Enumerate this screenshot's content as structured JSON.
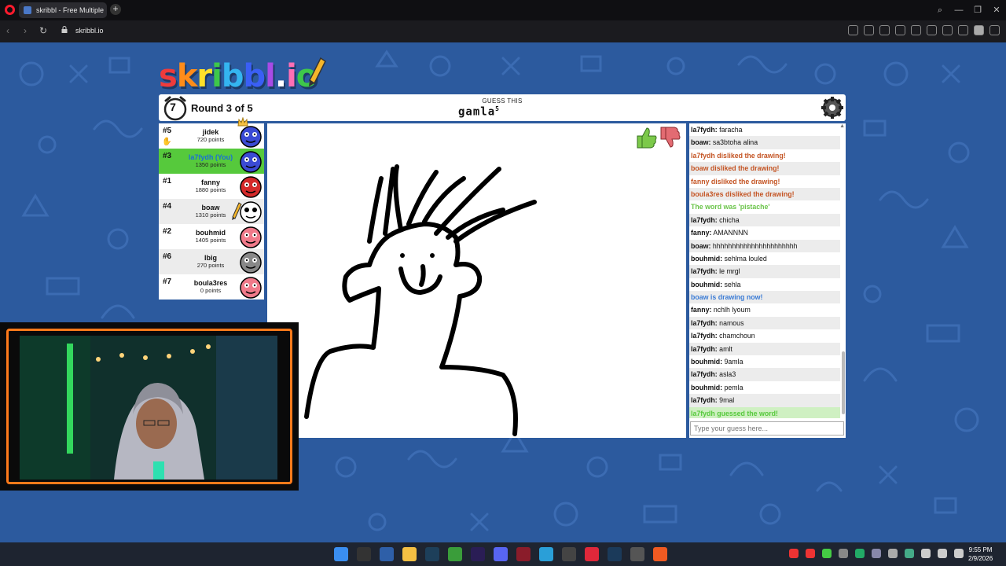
{
  "browser": {
    "tab_title": "skribbl - Free Multiple",
    "tab_close": "×",
    "new_tab": "+",
    "url": "skribbl.io",
    "window_buttons": [
      "—",
      "❐",
      "✕"
    ]
  },
  "game": {
    "logo_text": "skribbl.io",
    "timer": "7",
    "round_text": "Round 3 of 5",
    "guess_label": "GUESS THIS",
    "guess_word": "gamla",
    "word_length": "5"
  },
  "players": [
    {
      "rank": "#5",
      "name": "jidek",
      "points": "720 points",
      "face_color": "#3b4bd4"
    },
    {
      "rank": "#3",
      "name": "la7fydh (You)",
      "points": "1350 points",
      "face_color": "#3b4bd4"
    },
    {
      "rank": "#1",
      "name": "fanny",
      "points": "1880 points",
      "face_color": "#d42a2a"
    },
    {
      "rank": "#4",
      "name": "boaw",
      "points": "1310 points",
      "face_color": "#ffffff"
    },
    {
      "rank": "#2",
      "name": "bouhmid",
      "points": "1405 points",
      "face_color": "#f07a8a"
    },
    {
      "rank": "#6",
      "name": "lbig",
      "points": "270 points",
      "face_color": "#888888"
    },
    {
      "rank": "#7",
      "name": "boula3res",
      "points": "0 points",
      "face_color": "#f07a8a"
    }
  ],
  "chat": {
    "messages": [
      {
        "type": "chat",
        "user": "la7fydh:",
        "text": " faracha"
      },
      {
        "type": "chat",
        "user": "boaw:",
        "text": " sa3btoha alina"
      },
      {
        "type": "disliked",
        "user": "",
        "text": "la7fydh disliked the drawing!"
      },
      {
        "type": "disliked",
        "user": "",
        "text": "boaw disliked the drawing!"
      },
      {
        "type": "disliked",
        "user": "",
        "text": "fanny disliked the drawing!"
      },
      {
        "type": "disliked",
        "user": "",
        "text": "boula3res disliked the drawing!"
      },
      {
        "type": "word",
        "user": "",
        "text": "The word was 'pistache'"
      },
      {
        "type": "chat",
        "user": "la7fydh:",
        "text": " chicha"
      },
      {
        "type": "chat",
        "user": "fanny:",
        "text": " AMANNNN"
      },
      {
        "type": "chat",
        "user": "boaw:",
        "text": " hhhhhhhhhhhhhhhhhhhhhh"
      },
      {
        "type": "chat",
        "user": "bouhmid:",
        "text": " sehlma louled"
      },
      {
        "type": "chat",
        "user": "la7fydh:",
        "text": " le mrgl"
      },
      {
        "type": "chat",
        "user": "bouhmid:",
        "text": " sehla"
      },
      {
        "type": "drawing",
        "user": "",
        "text": "boaw is drawing now!"
      },
      {
        "type": "chat",
        "user": "fanny:",
        "text": " nchlh lyoum"
      },
      {
        "type": "chat",
        "user": "la7fydh:",
        "text": " namous"
      },
      {
        "type": "chat",
        "user": "la7fydh:",
        "text": " chamchoun"
      },
      {
        "type": "chat",
        "user": "la7fydh:",
        "text": " amlt"
      },
      {
        "type": "chat",
        "user": "bouhmid:",
        "text": " 9amla"
      },
      {
        "type": "chat",
        "user": "la7fydh:",
        "text": " asla3"
      },
      {
        "type": "chat",
        "user": "bouhmid:",
        "text": " pemla"
      },
      {
        "type": "chat",
        "user": "la7fydh:",
        "text": " 9mal"
      },
      {
        "type": "guessed",
        "user": "",
        "text": "la7fydh guessed the word!"
      }
    ],
    "input_placeholder": "Type your guess here..."
  },
  "taskbar": {
    "time": "9:55 PM",
    "date": "2/9/2026"
  },
  "colors": {
    "page_bg": "#2c5a9e",
    "you_highlight": "#56c93c",
    "disliked": "#c45423",
    "drawing_now": "#3a7bd5",
    "correct": "#56c93c"
  }
}
